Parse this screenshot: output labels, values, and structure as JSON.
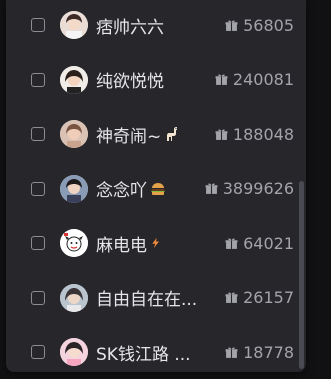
{
  "streamers": [
    {
      "name": "痞帅六六",
      "emoji": "",
      "count": "56805"
    },
    {
      "name": "纯欲悦悦",
      "emoji": "",
      "count": "240081"
    },
    {
      "name": "神奇闹~",
      "emoji": "llama",
      "count": "188048"
    },
    {
      "name": "念念吖",
      "emoji": "burger",
      "count": "3899626"
    },
    {
      "name": "麻电电",
      "emoji": "bolt",
      "count": "64021"
    },
    {
      "name": "自由自在在...",
      "emoji": "",
      "count": "26157"
    },
    {
      "name": "SK钱江路 ...",
      "emoji": "",
      "count": "18778"
    }
  ],
  "colors": {
    "panel": "#26262b",
    "text": "#e6e6ea",
    "muted": "#a3a3aa"
  }
}
